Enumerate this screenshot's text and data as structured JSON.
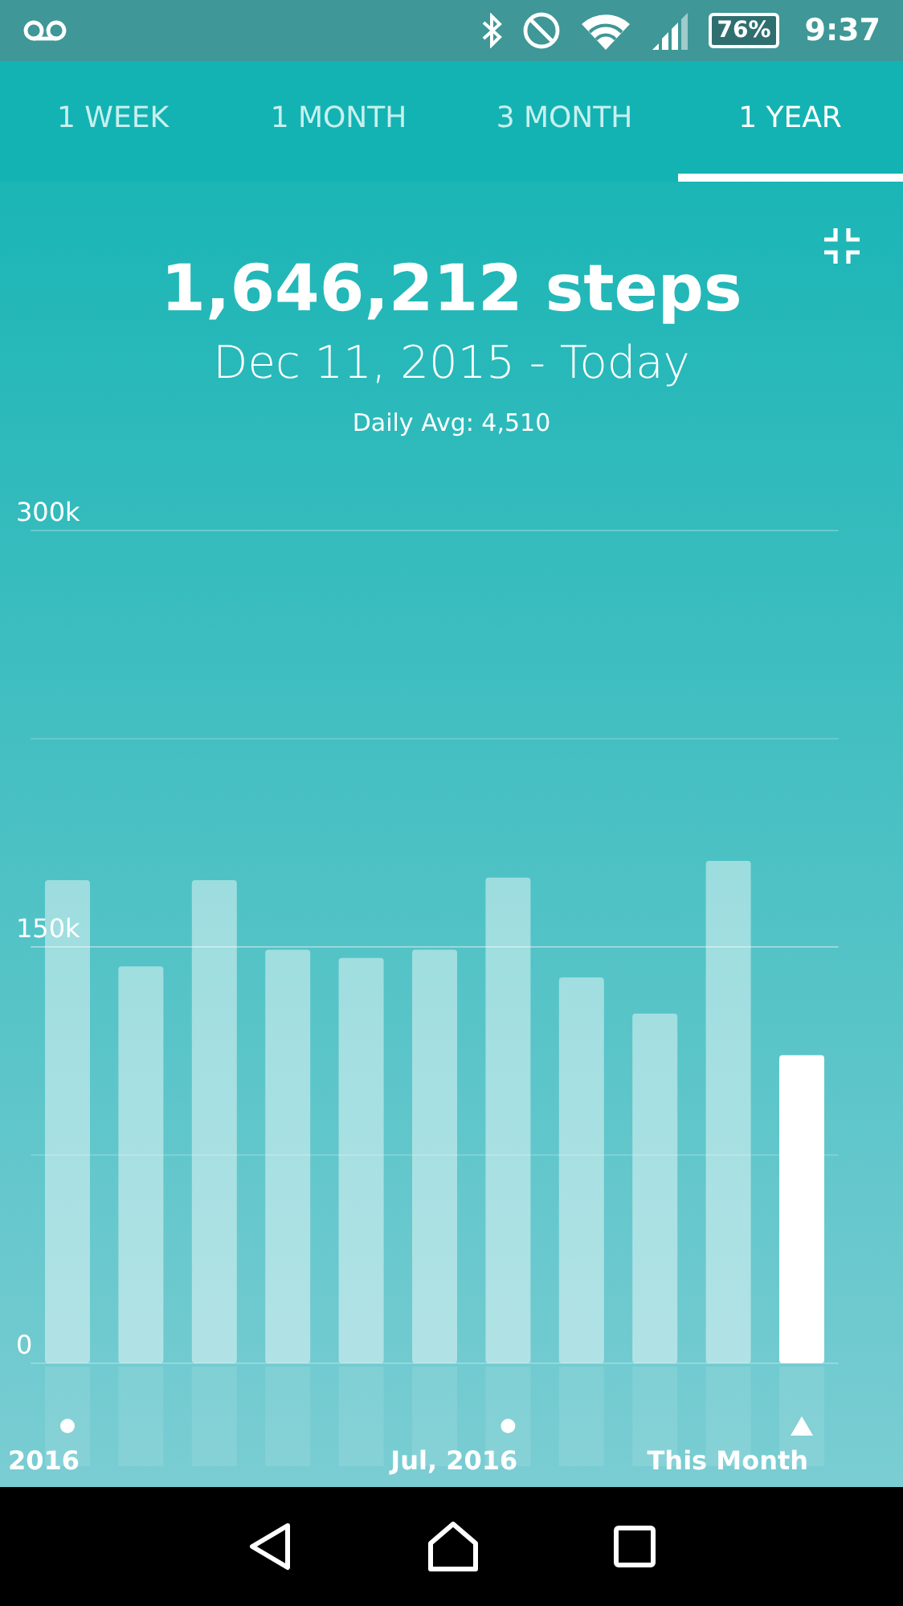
{
  "status_bar": {
    "battery": "76%",
    "time": "9:37"
  },
  "tabs": [
    {
      "label": "1 WEEK",
      "selected": false
    },
    {
      "label": "1 MONTH",
      "selected": false
    },
    {
      "label": "3 MONTH",
      "selected": false
    },
    {
      "label": "1 YEAR",
      "selected": true
    }
  ],
  "summary": {
    "total": "1,646,212 steps",
    "range": "Dec 11, 2015 - Today",
    "daily_avg": "Daily Avg: 4,510"
  },
  "chart": {
    "highlight_last": true,
    "chart_data": {
      "type": "bar",
      "values": [
        174000,
        143000,
        174000,
        149000,
        146000,
        149000,
        175000,
        139000,
        126000,
        181000,
        111000
      ],
      "ylim": [
        0,
        300000
      ],
      "yticks": [
        {
          "value": 0,
          "label": "0"
        },
        {
          "value": 150000,
          "label": "150k"
        },
        {
          "value": 300000,
          "label": "300k"
        }
      ]
    },
    "x_labels": [
      {
        "label": "2016",
        "kind": "dot"
      },
      {
        "label": "Jul, 2016",
        "kind": "dot"
      },
      {
        "label": "This Month",
        "kind": "triangle"
      }
    ]
  }
}
